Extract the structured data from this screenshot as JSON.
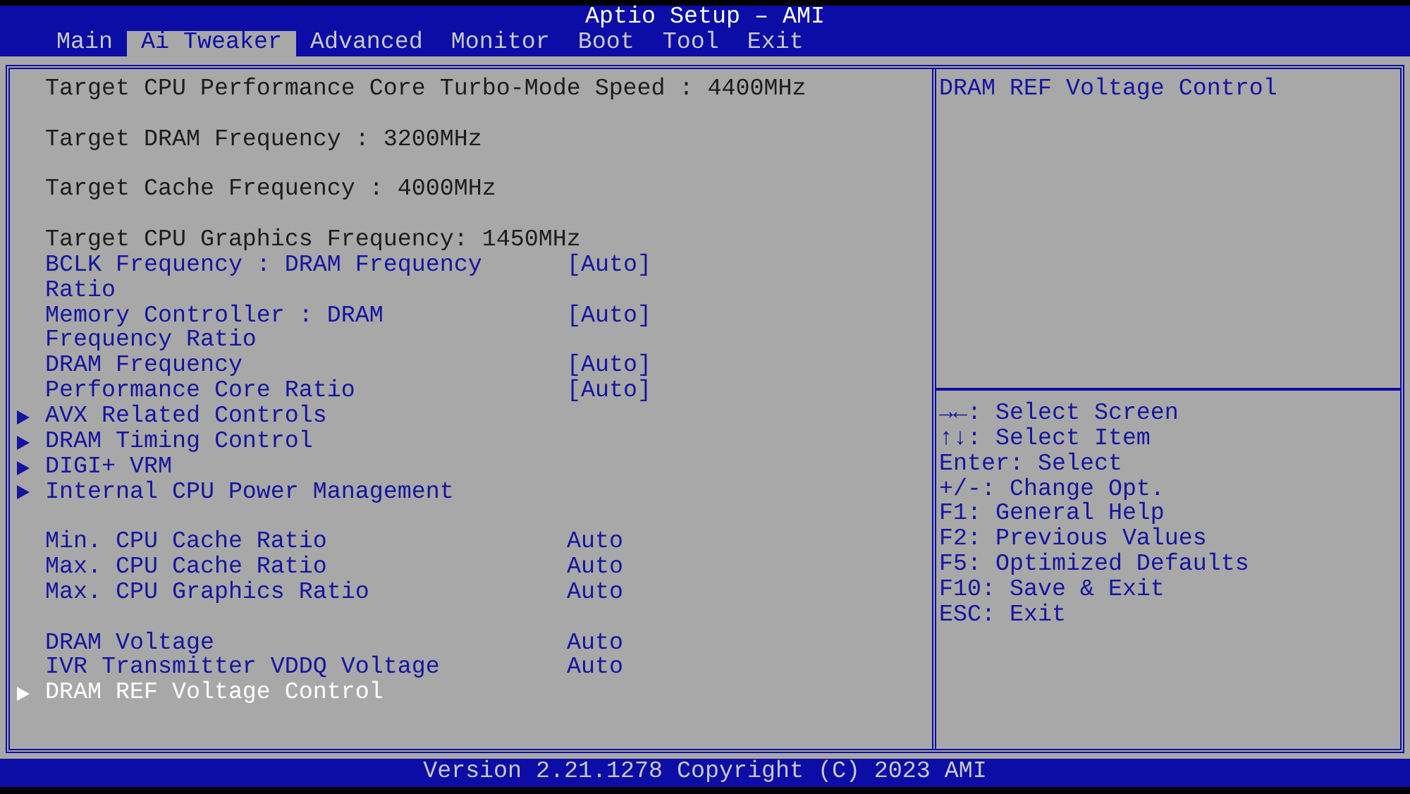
{
  "window": {
    "title": "Aptio Setup – AMI"
  },
  "tabs": [
    {
      "label": "Main",
      "selected": false
    },
    {
      "label": "Ai Tweaker",
      "selected": true
    },
    {
      "label": "Advanced",
      "selected": false
    },
    {
      "label": "Monitor",
      "selected": false
    },
    {
      "label": "Boot",
      "selected": false
    },
    {
      "label": "Tool",
      "selected": false
    },
    {
      "label": "Exit",
      "selected": false
    }
  ],
  "items": [
    {
      "kind": "info",
      "text": "Target CPU Performance Core Turbo-Mode Speed : 4400MHz"
    },
    {
      "kind": "gap"
    },
    {
      "kind": "info",
      "text": "Target DRAM Frequency : 3200MHz"
    },
    {
      "kind": "gap"
    },
    {
      "kind": "info",
      "text": "Target Cache Frequency : 4000MHz"
    },
    {
      "kind": "gap"
    },
    {
      "kind": "info",
      "text": "Target CPU Graphics Frequency: 1450MHz"
    },
    {
      "kind": "setting",
      "label": "BCLK Frequency : DRAM Frequency Ratio",
      "value": "[Auto]",
      "selected": false
    },
    {
      "kind": "setting",
      "label": "Memory Controller : DRAM Frequency Ratio",
      "value": "[Auto]",
      "selected": false
    },
    {
      "kind": "setting",
      "label": "DRAM Frequency",
      "value": "[Auto]",
      "selected": false
    },
    {
      "kind": "setting",
      "label": "Performance Core Ratio",
      "value": "[Auto]",
      "selected": false
    },
    {
      "kind": "submenu",
      "label": "AVX Related Controls",
      "selected": false
    },
    {
      "kind": "submenu",
      "label": "DRAM Timing Control",
      "selected": false
    },
    {
      "kind": "submenu",
      "label": "DIGI+ VRM",
      "selected": false
    },
    {
      "kind": "submenu",
      "label": "Internal CPU Power Management",
      "selected": false
    },
    {
      "kind": "gap"
    },
    {
      "kind": "setting",
      "label": "Min. CPU Cache Ratio",
      "value": "Auto",
      "selected": false
    },
    {
      "kind": "setting",
      "label": "Max. CPU Cache Ratio",
      "value": "Auto",
      "selected": false
    },
    {
      "kind": "setting",
      "label": "Max. CPU Graphics Ratio",
      "value": "Auto",
      "selected": false
    },
    {
      "kind": "gap"
    },
    {
      "kind": "setting",
      "label": "DRAM Voltage",
      "value": "Auto",
      "selected": false
    },
    {
      "kind": "setting",
      "label": "IVR Transmitter VDDQ Voltage",
      "value": "Auto",
      "selected": false
    },
    {
      "kind": "submenu",
      "label": "DRAM REF Voltage Control",
      "selected": true
    }
  ],
  "help": {
    "description": "DRAM REF Voltage Control",
    "keys": [
      "→←: Select Screen",
      "↑↓: Select Item",
      "Enter: Select",
      "+/-: Change Opt.",
      "F1: General Help",
      "F2: Previous Values",
      "F5: Optimized Defaults",
      "F10: Save & Exit",
      "ESC: Exit"
    ]
  },
  "status_bar": "Version 2.21.1278 Copyright (C) 2023 AMI"
}
